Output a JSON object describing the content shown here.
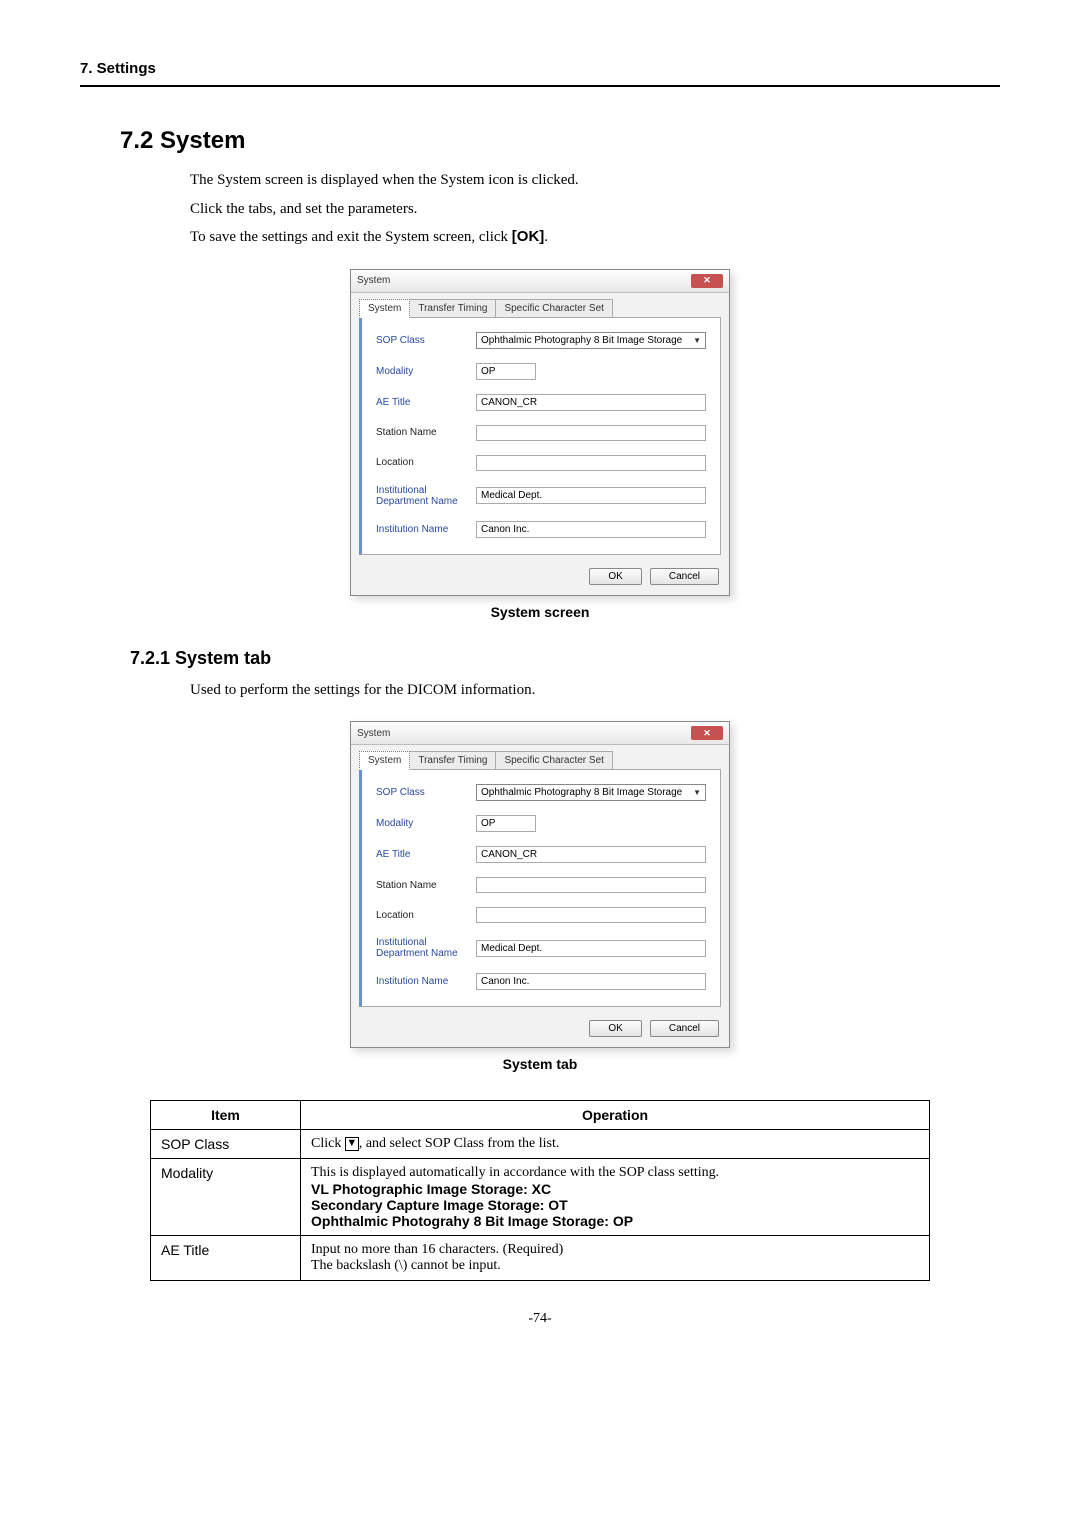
{
  "header": {
    "chapter": "7. Settings"
  },
  "section": {
    "number_title": "7.2 System",
    "p1": "The System screen is displayed when the System icon is clicked.",
    "p2": "Click the tabs, and set the parameters.",
    "p3_prefix": "To save the settings and exit the System screen, click ",
    "p3_bold": "[OK]",
    "p3_suffix": "."
  },
  "dialog": {
    "title": "System",
    "tabs": {
      "system": "System",
      "transfer": "Transfer Timing",
      "charset": "Specific Character Set"
    },
    "labels": {
      "sop_class": "SOP Class",
      "modality": "Modality",
      "ae_title": "AE Title",
      "station_name": "Station Name",
      "location": "Location",
      "inst_dept": "Institutional Department Name",
      "inst_name": "Institution Name"
    },
    "values": {
      "sop_class": "Ophthalmic Photography 8 Bit Image Storage",
      "modality": "OP",
      "ae_title": "CANON_CR",
      "station_name": "",
      "location": "",
      "inst_dept": "Medical Dept.",
      "inst_name": "Canon Inc."
    },
    "buttons": {
      "ok": "OK",
      "cancel": "Cancel"
    }
  },
  "caption1": "System screen",
  "subsection": {
    "title": "7.2.1 System tab",
    "p1": "Used to perform the settings for the DICOM information."
  },
  "caption2": "System tab",
  "table": {
    "head": {
      "item": "Item",
      "operation": "Operation"
    },
    "rows": [
      {
        "item": "SOP Class",
        "op_prefix": "Click ",
        "op_suffix": ", and select SOP Class from the list."
      },
      {
        "item": "Modality",
        "op_line1": "This is displayed automatically in accordance with the SOP class setting.",
        "op_line2": "VL Photographic Image Storage: XC",
        "op_line3": "Secondary Capture Image Storage: OT",
        "op_line4": "Ophthalmic Photograhy 8 Bit Image Storage: OP"
      },
      {
        "item": "AE Title",
        "op_line1": "Input no more than 16 characters. (Required)",
        "op_line2": "The backslash (\\) cannot be input."
      }
    ]
  },
  "page_number": "-74-"
}
